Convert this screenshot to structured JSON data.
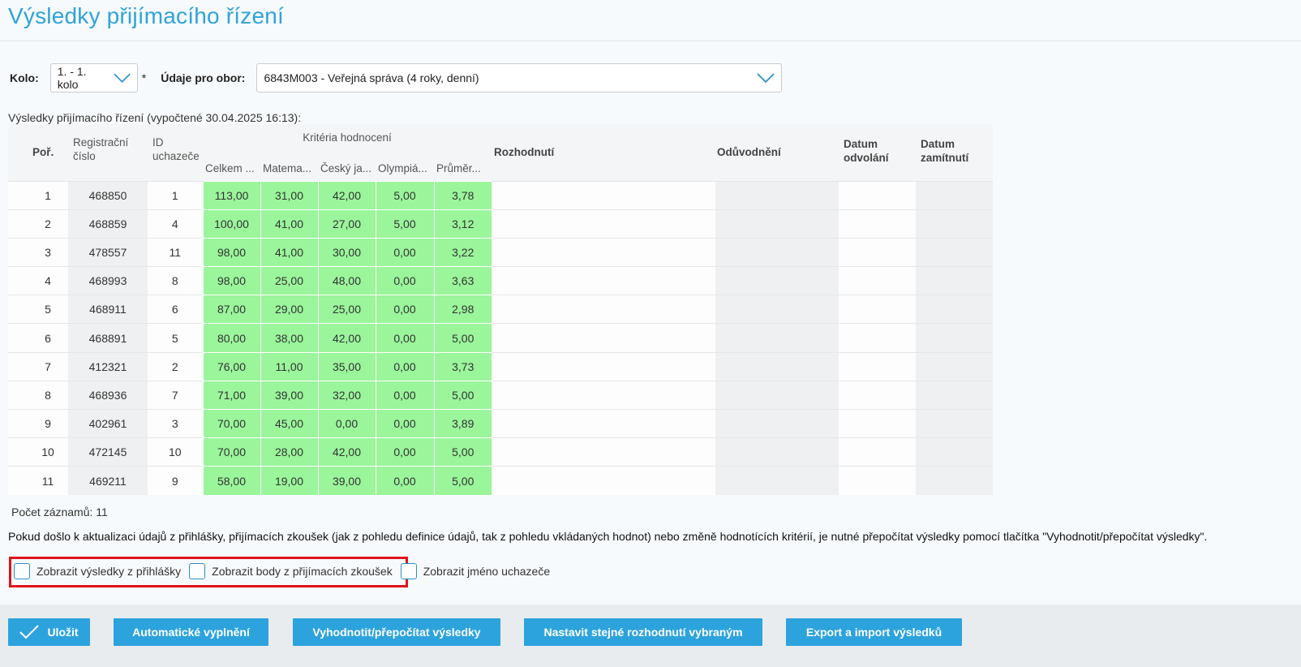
{
  "page": {
    "title": "Výsledky přijímacího řízení"
  },
  "filters": {
    "kolo_label": "Kolo:",
    "kolo_value": "1. - 1. kolo",
    "required_mark": "*",
    "obor_label": "Údaje pro obor:",
    "obor_value": "6843M003 - Veřejná správa (4 roky, denní)"
  },
  "results_caption": "Výsledky přijímacího řízení (vypočtené 30.04.2025 16:13):",
  "table": {
    "headers": {
      "por": "Poř.",
      "reg": "Registrační číslo",
      "id": "ID uchazeče",
      "criteria_group": "Kritéria hodnocení",
      "celkem": "Celkem ...",
      "matema": "Matema...",
      "cesky": "Český ja...",
      "olympia": "Olympiá...",
      "prumer": "Průměr...",
      "rozhodnuti": "Rozhodnutí",
      "oduvodneni": "Odůvodnění",
      "datum_odvolani": "Datum odvolání",
      "datum_zamitnuti": "Datum zamítnutí"
    },
    "rows": [
      [
        "1",
        "468850",
        "1",
        "113,00",
        "31,00",
        "42,00",
        "5,00",
        "3,78"
      ],
      [
        "2",
        "468859",
        "4",
        "100,00",
        "41,00",
        "27,00",
        "5,00",
        "3,12"
      ],
      [
        "3",
        "478557",
        "11",
        "98,00",
        "41,00",
        "30,00",
        "0,00",
        "3,22"
      ],
      [
        "4",
        "468993",
        "8",
        "98,00",
        "25,00",
        "48,00",
        "0,00",
        "3,63"
      ],
      [
        "5",
        "468911",
        "6",
        "87,00",
        "29,00",
        "25,00",
        "0,00",
        "2,98"
      ],
      [
        "6",
        "468891",
        "5",
        "80,00",
        "38,00",
        "42,00",
        "0,00",
        "5,00"
      ],
      [
        "7",
        "412321",
        "2",
        "76,00",
        "11,00",
        "35,00",
        "0,00",
        "3,73"
      ],
      [
        "8",
        "468936",
        "7",
        "71,00",
        "39,00",
        "32,00",
        "0,00",
        "5,00"
      ],
      [
        "9",
        "402961",
        "3",
        "70,00",
        "45,00",
        "0,00",
        "0,00",
        "3,89"
      ],
      [
        "10",
        "472145",
        "10",
        "70,00",
        "28,00",
        "42,00",
        "0,00",
        "5,00"
      ],
      [
        "11",
        "469211",
        "9",
        "58,00",
        "19,00",
        "39,00",
        "0,00",
        "5,00"
      ]
    ]
  },
  "record_count": "Počet záznamů: 11",
  "note": "Pokud došlo k aktualizaci údajů z přihlášky, přijímacích zkoušek (jak z pohledu definice údajů, tak z pohledu vkládaných hodnot) nebo změně hodnotících kritérií, je nutné přepočítat výsledky pomocí tlačítka \"Vyhodnotit/přepočítat výsledky\".",
  "checkboxes": {
    "show_application": "Zobrazit výsledky z přihlášky",
    "show_exam": "Zobrazit body z přijímacích zkoušek",
    "show_name": "Zobrazit jméno uchazeče"
  },
  "buttons": {
    "save": "Uložit",
    "autofill": "Automatické vyplnění",
    "evaluate": "Vyhodnotit/přepočítat výsledky",
    "set_same": "Nastavit stejné rozhodnutí vybraným",
    "export": "Export a import výsledků"
  },
  "colors": {
    "accent": "#2da3dd",
    "title": "#2fa3d8",
    "criteria_cell": "#9af59b",
    "highlight_frame": "#e0121a"
  }
}
